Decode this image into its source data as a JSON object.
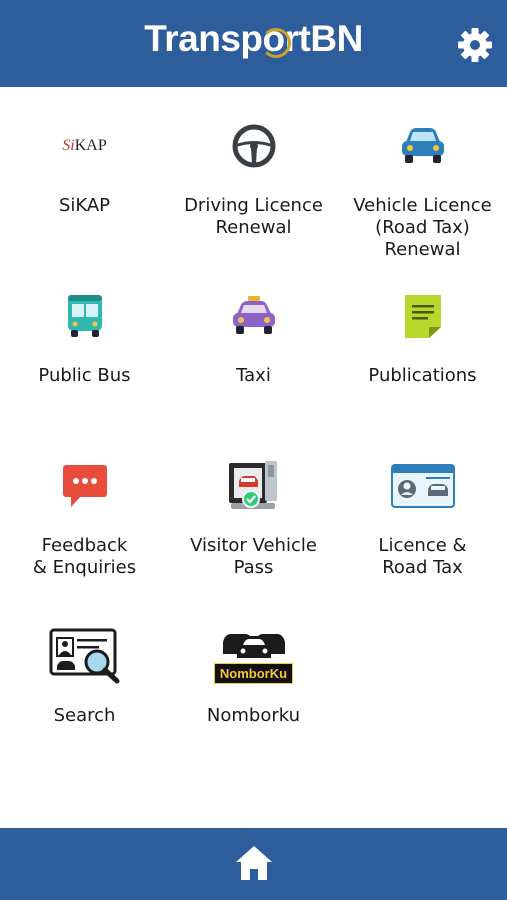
{
  "header": {
    "logo_prefix": "Transp",
    "logo_o": "o",
    "logo_suffix": "rtBN",
    "settings_icon": "gear-icon",
    "colors": {
      "bar": "#2e5d9b",
      "accent": "#c9a227"
    }
  },
  "menu": [
    {
      "label_lines": [
        "SiKAP"
      ],
      "icon": "sikap-logo-icon",
      "logo_text_si": "Si",
      "logo_text_kap": "KAP"
    },
    {
      "label_lines": [
        "Driving Licence",
        "Renewal"
      ],
      "icon": "steering-wheel-icon"
    },
    {
      "label_lines": [
        "Vehicle Licence",
        "(Road Tax)",
        "Renewal"
      ],
      "icon": "car-icon"
    },
    {
      "label_lines": [
        "Public Bus"
      ],
      "icon": "bus-icon"
    },
    {
      "label_lines": [
        "Taxi"
      ],
      "icon": "taxi-icon"
    },
    {
      "label_lines": [
        "Publications"
      ],
      "icon": "document-icon"
    },
    {
      "label_lines": [
        "Feedback",
        "& Enquiries"
      ],
      "icon": "chat-bubble-icon"
    },
    {
      "label_lines": [
        "Visitor Vehicle",
        "Pass"
      ],
      "icon": "visitor-pass-icon"
    },
    {
      "label_lines": [
        "Licence &",
        "Road Tax"
      ],
      "icon": "licence-card-icon"
    },
    {
      "label_lines": [
        "Search"
      ],
      "icon": "id-search-icon"
    },
    {
      "label_lines": [
        "Nomborku"
      ],
      "icon": "nomborku-icon",
      "badge_text": "NomborKu"
    }
  ],
  "footer": {
    "home_icon": "home-icon"
  }
}
